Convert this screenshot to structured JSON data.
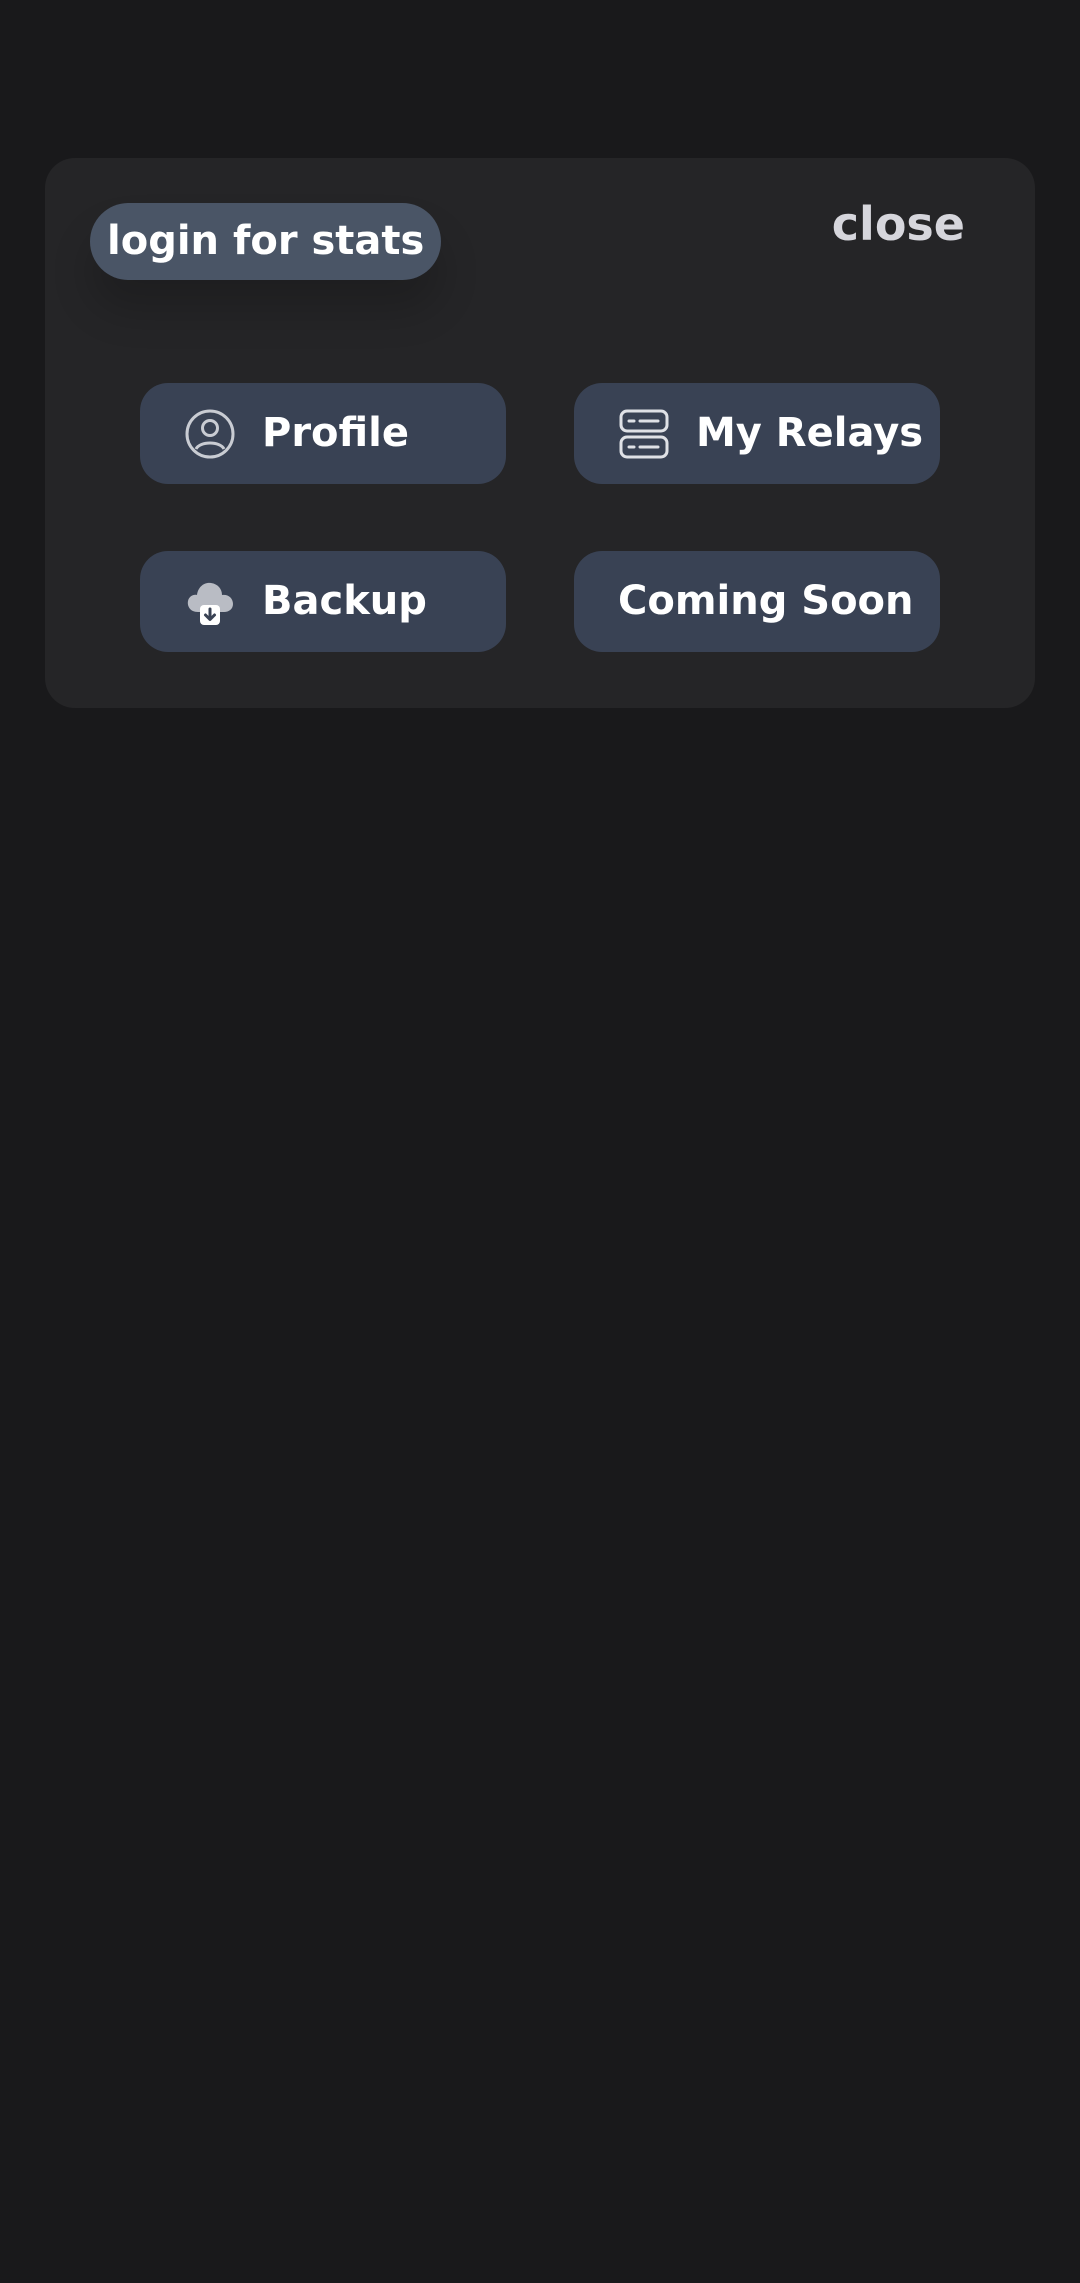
{
  "modal": {
    "login_label": "login for stats",
    "close_label": "close"
  },
  "menu": {
    "items": [
      {
        "label": "Profile",
        "icon": "user-circle-icon"
      },
      {
        "label": "My Relays",
        "icon": "server-icon"
      },
      {
        "label": "Backup",
        "icon": "cloud-download-icon"
      },
      {
        "label": "Coming Soon",
        "icon": ""
      }
    ]
  },
  "colors": {
    "background": "#19191b",
    "panel": "#252527",
    "tile": "#394254",
    "pill": "#4a5566",
    "text": "#ffffff"
  }
}
